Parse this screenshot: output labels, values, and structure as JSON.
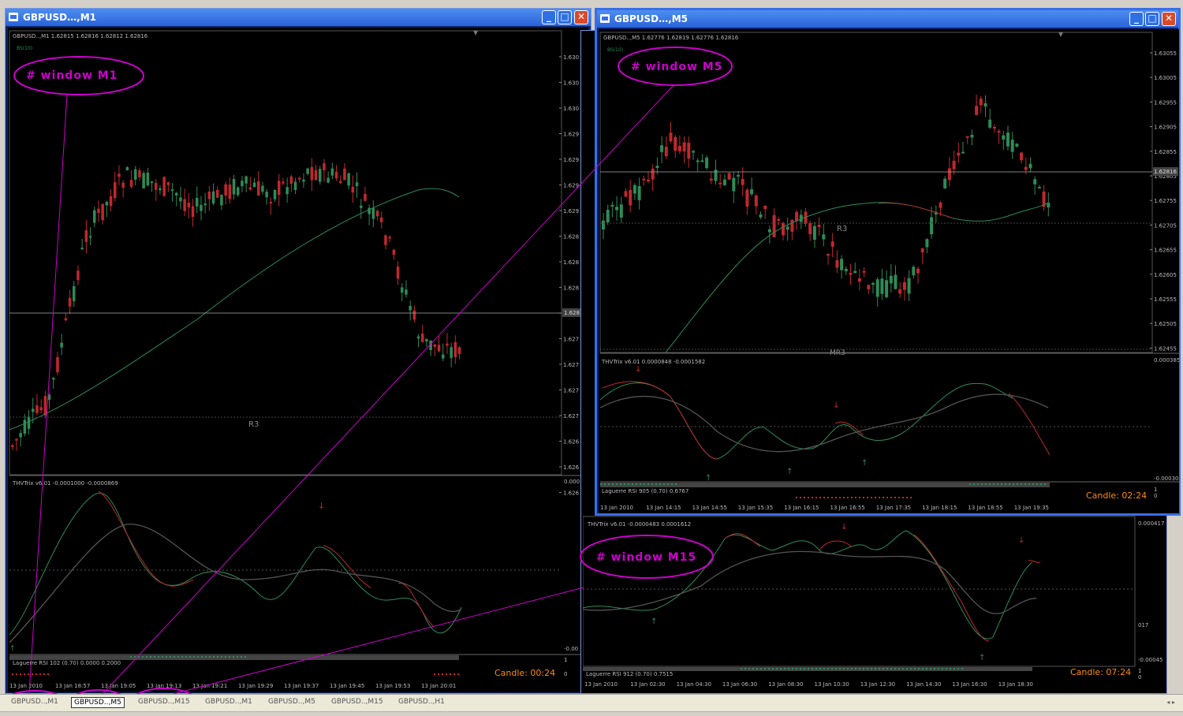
{
  "windows": {
    "m1": {
      "title": "GBPUSD…,M1",
      "info": "GBPUSD..,M1  1.62815 1.62816 1.62812 1.62816",
      "indicator_label": "BS(10)",
      "prices": [
        "1.630",
        "1.630",
        "1.630",
        "1.629",
        "1.629",
        "1.629",
        "1.629",
        "1.628",
        "1.628",
        "1.628",
        "1.628",
        "1.627",
        "1.627",
        "1.627",
        "1.627",
        "1.626",
        "1.626",
        "1.626"
      ],
      "last_price": "1.628",
      "r3": "R3",
      "osc_label": "THVTrix v6.01 -0.0001000 -0.0000869",
      "osc_scale_top": "0.000",
      "osc_scale_bottom": "-0.00",
      "laguerre": "Laguerre RSI 102 (0.70) 0.0000 0.2000",
      "lag_scale": [
        "1",
        "0"
      ],
      "candle_timer": "Candle: 00:24",
      "times": [
        "13 Jan 2010",
        "13 Jan 18:57",
        "13 Jan 19:05",
        "13 Jan 19:13",
        "13 Jan 19:21",
        "13 Jan 19:29",
        "13 Jan 19:37",
        "13 Jan 19:45",
        "13 Jan 19:53",
        "13 Jan 20:01"
      ]
    },
    "m5": {
      "title": "GBPUSD…,M5",
      "info": "GBPUSD..,M5  1.62776 1.62819 1.62776 1.62816",
      "indicator_label": "BS(10)",
      "prices": [
        "1.63055",
        "1.63005",
        "1.62955",
        "1.62905",
        "1.62855",
        "1.62805",
        "1.62755",
        "1.62705",
        "1.62655",
        "1.62605",
        "1.62555",
        "1.62505",
        "1.62455"
      ],
      "last_price": "1.62816",
      "r3": "R3",
      "mr3": "MR3",
      "osc_label": "THVTrix v6.01 0.0000848 -0.0001582",
      "osc_scale_top": "0.000385",
      "osc_scale_bottom": "-0.00030",
      "laguerre": "Laguerre RSI 905 (0.70) 0.6767",
      "lag_scale": [
        "1",
        "0"
      ],
      "candle_timer": "Candle: 02:24",
      "times": [
        "13 Jan 2010",
        "13 Jan 14:15",
        "13 Jan 14:55",
        "13 Jan 15:35",
        "13 Jan 16:15",
        "13 Jan 16:55",
        "13 Jan 17:35",
        "13 Jan 18:15",
        "13 Jan 18:55",
        "13 Jan 19:35"
      ]
    },
    "m15": {
      "osc_label": "THVTrix v6.01 -0.0000483 0.0001612",
      "osc_scale_top": "0.000417",
      "osc_scale_mid": "017",
      "osc_scale_bottom": "-0.00045",
      "laguerre": "Laguerre RSI 912 (0.70) 0.7515",
      "lag_scale": [
        "1",
        "0"
      ],
      "candle_timer": "Candle: 07:24",
      "times": [
        "13 Jan 2010",
        "13 Jan 02:30",
        "13 Jan 04:30",
        "13 Jan 06:30",
        "13 Jan 08:30",
        "13 Jan 10:30",
        "13 Jan 12:30",
        "13 Jan 14:30",
        "13 Jan 16:30",
        "13 Jan 18:30"
      ]
    }
  },
  "annotations": {
    "m1": "# window M1",
    "m5": "# window M5",
    "m15": "# window M15"
  },
  "taskbar_tabs": [
    "GBPUSD..,M1",
    "GBPUSD..,M5",
    "GBPUSD..,M15",
    "GBPUSD..,M1",
    "GBPUSD..,M5",
    "GBPUSD..,M15",
    "GBPUSD..,H1"
  ],
  "colors": {
    "bull": "#2e8b57",
    "bear": "#c0282d",
    "annotation": "#cc00cc",
    "timer": "#ff8c00"
  }
}
